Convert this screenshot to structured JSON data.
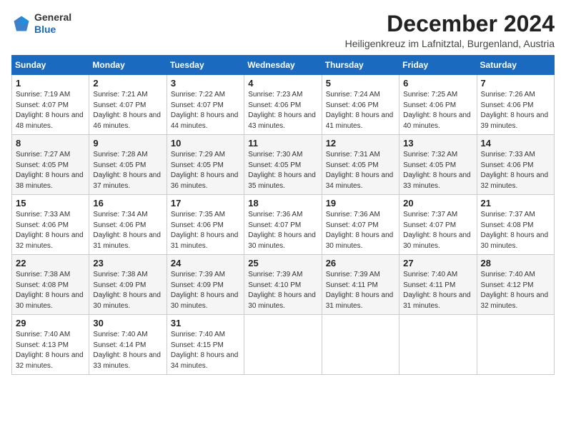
{
  "header": {
    "logo_general": "General",
    "logo_blue": "Blue",
    "month_title": "December 2024",
    "location": "Heiligenkreuz im Lafnitztal, Burgenland, Austria"
  },
  "weekdays": [
    "Sunday",
    "Monday",
    "Tuesday",
    "Wednesday",
    "Thursday",
    "Friday",
    "Saturday"
  ],
  "weeks": [
    [
      {
        "day": "1",
        "sunrise": "7:19 AM",
        "sunset": "4:07 PM",
        "daylight": "8 hours and 48 minutes."
      },
      {
        "day": "2",
        "sunrise": "7:21 AM",
        "sunset": "4:07 PM",
        "daylight": "8 hours and 46 minutes."
      },
      {
        "day": "3",
        "sunrise": "7:22 AM",
        "sunset": "4:07 PM",
        "daylight": "8 hours and 44 minutes."
      },
      {
        "day": "4",
        "sunrise": "7:23 AM",
        "sunset": "4:06 PM",
        "daylight": "8 hours and 43 minutes."
      },
      {
        "day": "5",
        "sunrise": "7:24 AM",
        "sunset": "4:06 PM",
        "daylight": "8 hours and 41 minutes."
      },
      {
        "day": "6",
        "sunrise": "7:25 AM",
        "sunset": "4:06 PM",
        "daylight": "8 hours and 40 minutes."
      },
      {
        "day": "7",
        "sunrise": "7:26 AM",
        "sunset": "4:06 PM",
        "daylight": "8 hours and 39 minutes."
      }
    ],
    [
      {
        "day": "8",
        "sunrise": "7:27 AM",
        "sunset": "4:05 PM",
        "daylight": "8 hours and 38 minutes."
      },
      {
        "day": "9",
        "sunrise": "7:28 AM",
        "sunset": "4:05 PM",
        "daylight": "8 hours and 37 minutes."
      },
      {
        "day": "10",
        "sunrise": "7:29 AM",
        "sunset": "4:05 PM",
        "daylight": "8 hours and 36 minutes."
      },
      {
        "day": "11",
        "sunrise": "7:30 AM",
        "sunset": "4:05 PM",
        "daylight": "8 hours and 35 minutes."
      },
      {
        "day": "12",
        "sunrise": "7:31 AM",
        "sunset": "4:05 PM",
        "daylight": "8 hours and 34 minutes."
      },
      {
        "day": "13",
        "sunrise": "7:32 AM",
        "sunset": "4:05 PM",
        "daylight": "8 hours and 33 minutes."
      },
      {
        "day": "14",
        "sunrise": "7:33 AM",
        "sunset": "4:06 PM",
        "daylight": "8 hours and 32 minutes."
      }
    ],
    [
      {
        "day": "15",
        "sunrise": "7:33 AM",
        "sunset": "4:06 PM",
        "daylight": "8 hours and 32 minutes."
      },
      {
        "day": "16",
        "sunrise": "7:34 AM",
        "sunset": "4:06 PM",
        "daylight": "8 hours and 31 minutes."
      },
      {
        "day": "17",
        "sunrise": "7:35 AM",
        "sunset": "4:06 PM",
        "daylight": "8 hours and 31 minutes."
      },
      {
        "day": "18",
        "sunrise": "7:36 AM",
        "sunset": "4:07 PM",
        "daylight": "8 hours and 30 minutes."
      },
      {
        "day": "19",
        "sunrise": "7:36 AM",
        "sunset": "4:07 PM",
        "daylight": "8 hours and 30 minutes."
      },
      {
        "day": "20",
        "sunrise": "7:37 AM",
        "sunset": "4:07 PM",
        "daylight": "8 hours and 30 minutes."
      },
      {
        "day": "21",
        "sunrise": "7:37 AM",
        "sunset": "4:08 PM",
        "daylight": "8 hours and 30 minutes."
      }
    ],
    [
      {
        "day": "22",
        "sunrise": "7:38 AM",
        "sunset": "4:08 PM",
        "daylight": "8 hours and 30 minutes."
      },
      {
        "day": "23",
        "sunrise": "7:38 AM",
        "sunset": "4:09 PM",
        "daylight": "8 hours and 30 minutes."
      },
      {
        "day": "24",
        "sunrise": "7:39 AM",
        "sunset": "4:09 PM",
        "daylight": "8 hours and 30 minutes."
      },
      {
        "day": "25",
        "sunrise": "7:39 AM",
        "sunset": "4:10 PM",
        "daylight": "8 hours and 30 minutes."
      },
      {
        "day": "26",
        "sunrise": "7:39 AM",
        "sunset": "4:11 PM",
        "daylight": "8 hours and 31 minutes."
      },
      {
        "day": "27",
        "sunrise": "7:40 AM",
        "sunset": "4:11 PM",
        "daylight": "8 hours and 31 minutes."
      },
      {
        "day": "28",
        "sunrise": "7:40 AM",
        "sunset": "4:12 PM",
        "daylight": "8 hours and 32 minutes."
      }
    ],
    [
      {
        "day": "29",
        "sunrise": "7:40 AM",
        "sunset": "4:13 PM",
        "daylight": "8 hours and 32 minutes."
      },
      {
        "day": "30",
        "sunrise": "7:40 AM",
        "sunset": "4:14 PM",
        "daylight": "8 hours and 33 minutes."
      },
      {
        "day": "31",
        "sunrise": "7:40 AM",
        "sunset": "4:15 PM",
        "daylight": "8 hours and 34 minutes."
      },
      null,
      null,
      null,
      null
    ]
  ]
}
